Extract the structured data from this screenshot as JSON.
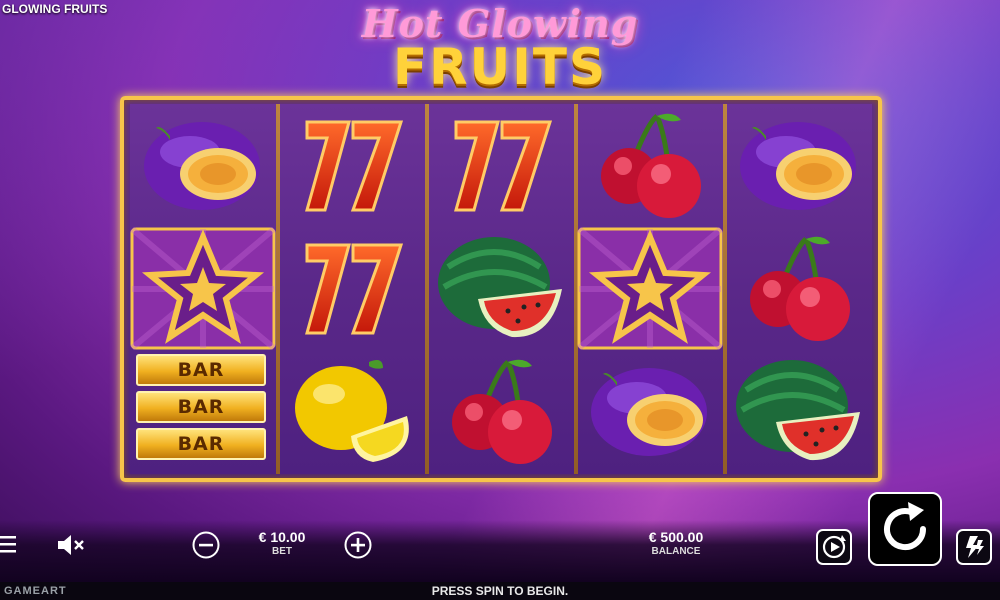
{
  "game": {
    "name": "GLOWING FRUITS"
  },
  "logo": {
    "line1": "Hot Glowing",
    "line2": "FRUITS"
  },
  "reels": [
    [
      "plum",
      "star",
      "bar-triple"
    ],
    [
      "seven",
      "seven",
      "lemon"
    ],
    [
      "seven",
      "watermelon",
      "cherry"
    ],
    [
      "cherry",
      "star",
      "plum"
    ],
    [
      "plum",
      "cherry",
      "watermelon"
    ]
  ],
  "symbols": {
    "bar_label": "BAR"
  },
  "controls": {
    "bet_value": "€ 10.00",
    "bet_label": "BET",
    "balance_value": "€ 500.00",
    "balance_label": "BALANCE"
  },
  "status": {
    "message": "PRESS SPIN TO BEGIN.",
    "brand": "GAMEART"
  },
  "colors": {
    "frame": "#f7c54a",
    "accent": "#ffd23a",
    "logo_pink": "#ff9ad8"
  }
}
